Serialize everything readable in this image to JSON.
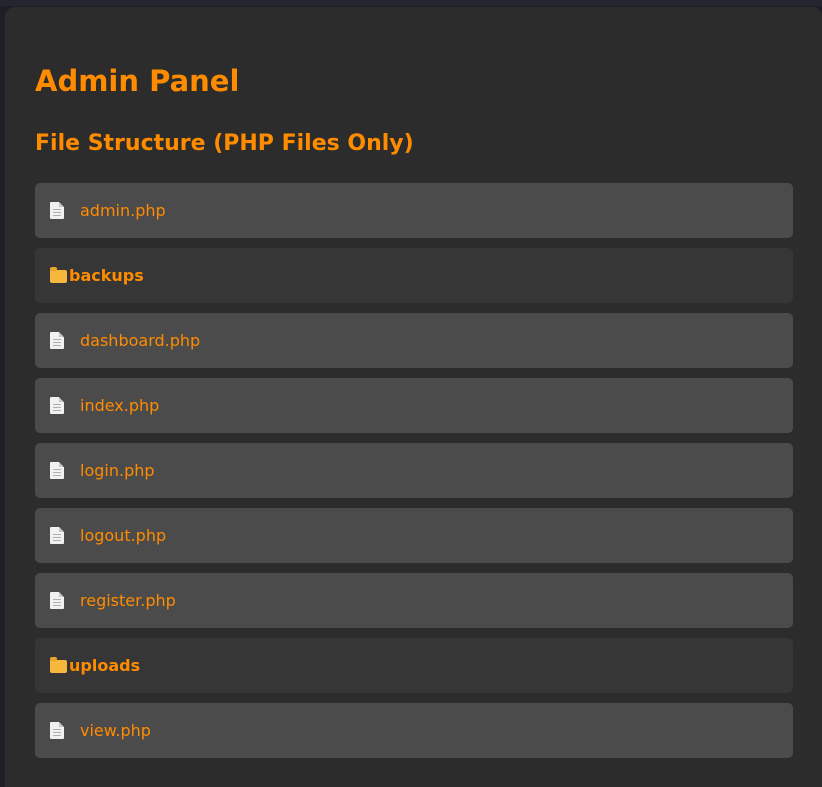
{
  "page": {
    "title": "Admin Panel",
    "section_title": "File Structure (PHP Files Only)"
  },
  "colors": {
    "accent": "#ff8c00",
    "panel_bg": "#2c2c2c",
    "file_row_bg": "#4b4b4b",
    "folder_row_bg": "#363636"
  },
  "files": [
    {
      "type": "file",
      "name": "admin.php",
      "icon": "file-icon"
    },
    {
      "type": "folder",
      "name": "backups",
      "icon": "folder-icon"
    },
    {
      "type": "file",
      "name": "dashboard.php",
      "icon": "file-icon"
    },
    {
      "type": "file",
      "name": "index.php",
      "icon": "file-icon"
    },
    {
      "type": "file",
      "name": "login.php",
      "icon": "file-icon"
    },
    {
      "type": "file",
      "name": "logout.php",
      "icon": "file-icon"
    },
    {
      "type": "file",
      "name": "register.php",
      "icon": "file-icon"
    },
    {
      "type": "folder",
      "name": "uploads",
      "icon": "folder-icon"
    },
    {
      "type": "file",
      "name": "view.php",
      "icon": "file-icon"
    }
  ]
}
